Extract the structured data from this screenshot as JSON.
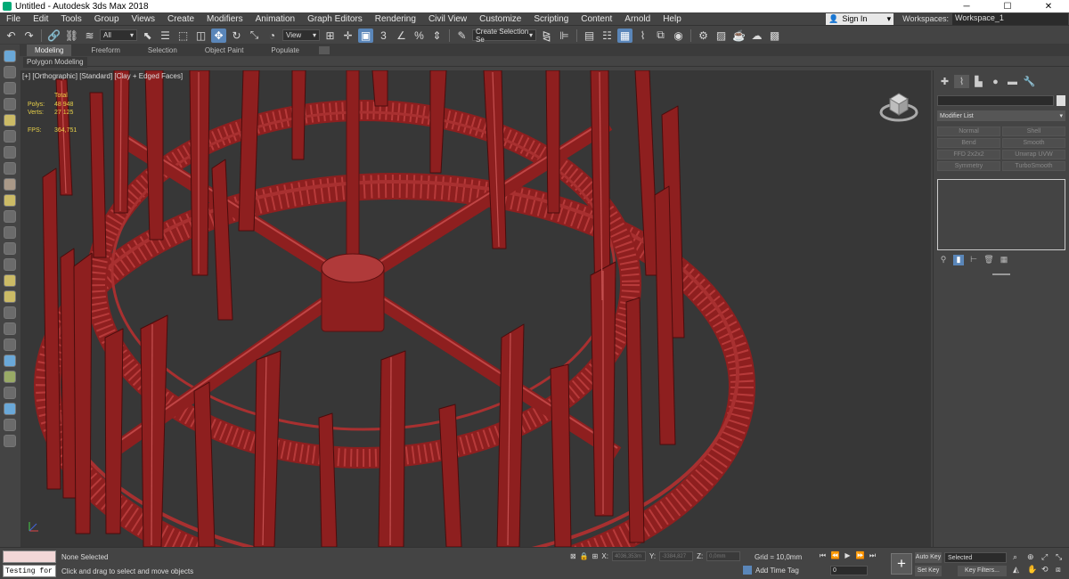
{
  "window": {
    "title": "Untitled - Autodesk 3ds Max 2018",
    "controls": [
      "─",
      "☐",
      "✕"
    ]
  },
  "menu": {
    "items": [
      "File",
      "Edit",
      "Tools",
      "Group",
      "Views",
      "Create",
      "Modifiers",
      "Animation",
      "Graph Editors",
      "Rendering",
      "Civil View",
      "Customize",
      "Scripting",
      "Content",
      "Arnold",
      "Help"
    ],
    "sign_in": "Sign In",
    "workspaces_label": "Workspaces:",
    "workspace_value": "Workspace_1"
  },
  "toolbar": {
    "filter_value": "All",
    "view_value": "View",
    "selection_set_placeholder": "Create Selection Se"
  },
  "ribbon": {
    "tabs": [
      "Modeling",
      "Freeform",
      "Selection",
      "Object Paint",
      "Populate"
    ],
    "active_tab": "Modeling",
    "panel_title": "Polygon Modeling"
  },
  "viewport": {
    "label": "[+] [Orthographic] [Standard] [Clay + Edged Faces]",
    "stats": {
      "total_label": "Total",
      "polys_label": "Polys:",
      "polys_value": "48 948",
      "verts_label": "Verts:",
      "verts_value": "27 125",
      "fps_label": "FPS:",
      "fps_value": "364,751"
    },
    "model_color": "#a52a2a"
  },
  "command_panel": {
    "modifier_list": "Modifier List",
    "modifier_buttons": [
      "Normal",
      "Shell",
      "Bend",
      "Smooth",
      "FFD 2x2x2",
      "Unwrap UVW",
      "Symmetry",
      "TurboSmooth"
    ]
  },
  "status": {
    "maxscript_input": "Testing for :",
    "selection": "None Selected",
    "prompt": "Click and drag to select and move objects",
    "x_label": "X:",
    "x_value": "4036,353m",
    "y_label": "Y:",
    "y_value": "-3384,827",
    "z_label": "Z:",
    "z_value": "0,0mm",
    "grid": "Grid = 10,0mm",
    "add_time_tag": "Add Time Tag",
    "frame": "0",
    "auto_key": "Auto Key",
    "set_key": "Set Key",
    "selected_dropdown": "Selected",
    "key_filters": "Key Filters..."
  }
}
